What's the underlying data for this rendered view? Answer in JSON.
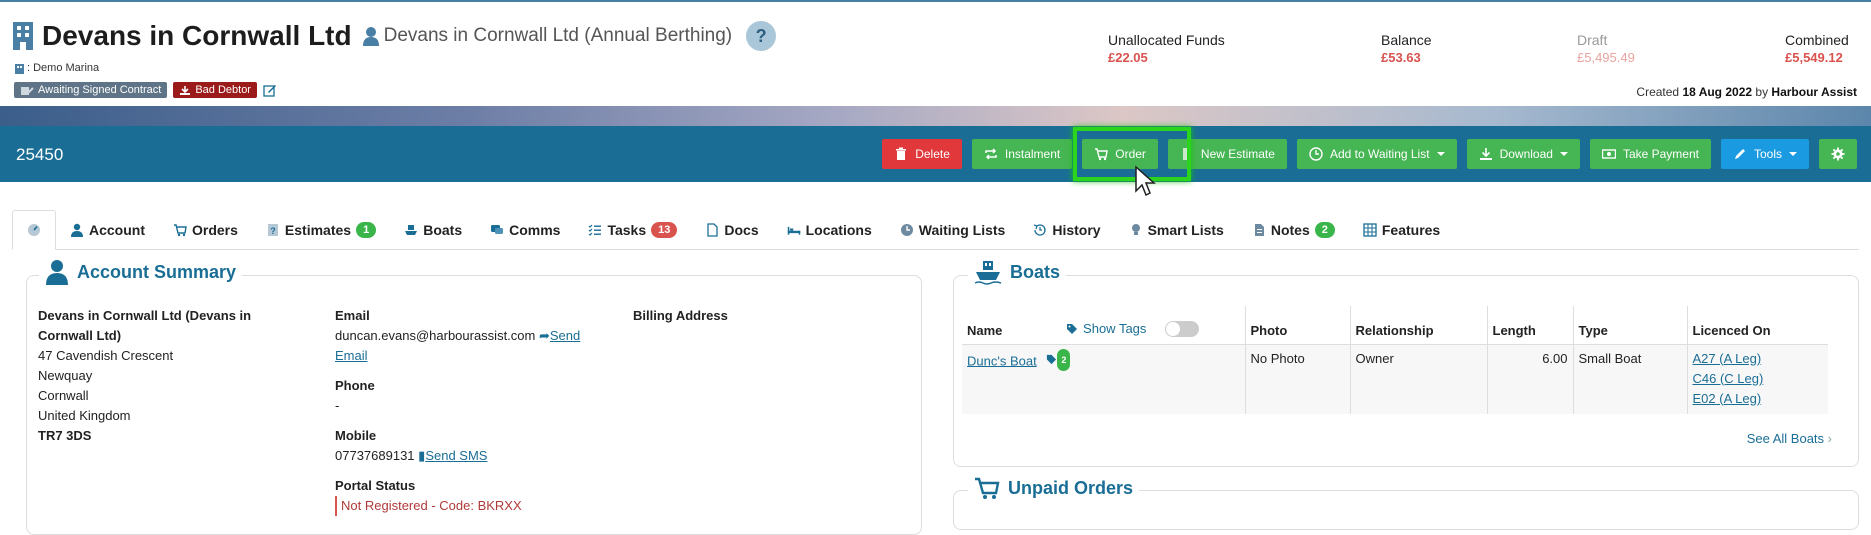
{
  "header": {
    "title": "Devans in Cornwall Ltd",
    "subtitle": "Devans in Cornwall Ltd (Annual Berthing)",
    "help_label": "?",
    "marina": ": Demo Marina",
    "badges": [
      "Awaiting Signed Contract",
      "Bad Debtor"
    ],
    "finance": [
      {
        "label": "Unallocated Funds",
        "value": "£22.05"
      },
      {
        "label": "Balance",
        "value": "£53.63"
      },
      {
        "label": "Draft",
        "value": "£5,495.49"
      },
      {
        "label": "Combined",
        "value": "£5,549.12"
      }
    ],
    "created_prefix": "Created",
    "created_date": "18 Aug 2022",
    "created_by_word": "by",
    "created_by": "Harbour Assist"
  },
  "toolbar": {
    "account_number": "25450",
    "buttons": {
      "delete": "Delete",
      "instalment": "Instalment",
      "order": "Order",
      "new_estimate": "New Estimate",
      "waiting_list": "Add to Waiting List",
      "download": "Download",
      "take_payment": "Take Payment",
      "tools": "Tools"
    }
  },
  "tabs": {
    "account": "Account",
    "orders": "Orders",
    "estimates": "Estimates",
    "estimates_count": "1",
    "boats": "Boats",
    "comms": "Comms",
    "tasks": "Tasks",
    "tasks_count": "13",
    "docs": "Docs",
    "locations": "Locations",
    "waiting_lists": "Waiting Lists",
    "history": "History",
    "smart_lists": "Smart Lists",
    "notes": "Notes",
    "notes_count": "2",
    "features": "Features"
  },
  "account_summary": {
    "title": "Account Summary",
    "address_lines": [
      "Devans in Cornwall Ltd (Devans in",
      "Cornwall Ltd)",
      "47 Cavendish Crescent",
      "Newquay",
      "Cornwall",
      "United Kingdom"
    ],
    "postcode": "TR7 3DS",
    "email_label": "Email",
    "email": "duncan.evans@harbourassist.com",
    "send_email": "Send",
    "send_email_2": "Email",
    "phone_label": "Phone",
    "phone": "-",
    "mobile_label": "Mobile",
    "mobile": "07737689131",
    "send_sms": "Send SMS",
    "portal_label": "Portal Status",
    "portal_status": "Not Registered - Code: BKRXX",
    "billing_label": "Billing Address"
  },
  "boats": {
    "title": "Boats",
    "columns": [
      "Name",
      "Photo",
      "Relationship",
      "Length",
      "Type",
      "Licenced On"
    ],
    "show_tags": "Show Tags",
    "rows": [
      {
        "name": "Dunc's Boat",
        "tag_count": "2",
        "photo": "No Photo",
        "relationship": "Owner",
        "length": "6.00",
        "type": "Small Boat",
        "licences": [
          "A27 (A Leg)",
          "C46 (C Leg)",
          "E02 (A Leg)"
        ]
      }
    ],
    "see_all": "See All Boats"
  },
  "unpaid_orders": {
    "title": "Unpaid Orders"
  },
  "colors": {
    "accent": "#1a6e96",
    "green": "#46b553",
    "red": "#e0383b",
    "blue": "#1a9ae0",
    "highlight": "#2bd51d"
  }
}
